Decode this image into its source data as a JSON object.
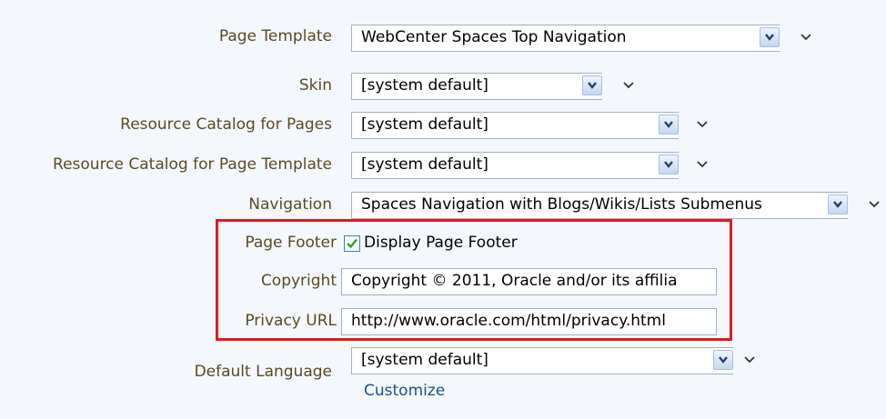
{
  "form": {
    "page_template": {
      "label": "Page Template",
      "value": "WebCenter Spaces Top Navigation"
    },
    "skin": {
      "label": "Skin",
      "value": "[system default]"
    },
    "resource_catalog_pages": {
      "label": "Resource Catalog for Pages",
      "value": "[system default]"
    },
    "resource_catalog_template": {
      "label": "Resource Catalog for Page Template",
      "value": "[system default]"
    },
    "navigation": {
      "label": "Navigation",
      "value": "Spaces Navigation with Blogs/Wikis/Lists Submenus"
    },
    "page_footer": {
      "label": "Page Footer",
      "checkbox_label": "Display Page Footer",
      "checked": true
    },
    "copyright": {
      "label": "Copyright",
      "value": "Copyright © 2011, Oracle and/or its affilia"
    },
    "privacy_url": {
      "label": "Privacy URL",
      "value": "http://www.oracle.com/html/privacy.html"
    },
    "default_language": {
      "label": "Default Language",
      "value": "[system default]",
      "link": "Customize"
    }
  },
  "colors": {
    "label": "#5a4a20",
    "link": "#1e4f8f",
    "highlight": "#e01b1b",
    "background": "#f4f8fd"
  }
}
